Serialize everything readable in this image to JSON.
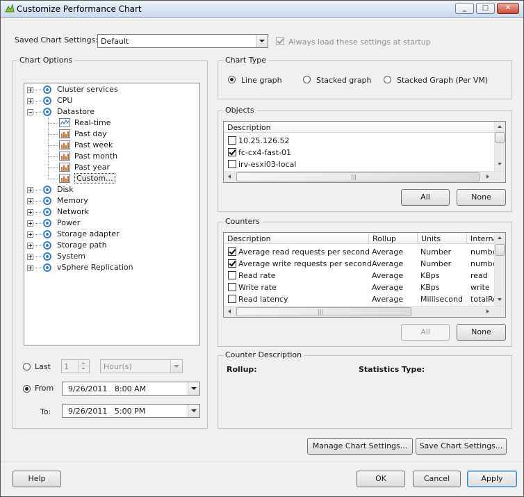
{
  "window": {
    "title": "Customize Performance Chart",
    "minimize_icon": "minimize-icon",
    "maximize_icon": "maximize-icon",
    "close_icon": "close-icon"
  },
  "saved_settings": {
    "label": "Saved Chart Settings:",
    "value": "Default",
    "always_load_label": "Always load these settings at startup",
    "always_load_checked": true
  },
  "chart_options": {
    "title": "Chart Options",
    "tree": [
      {
        "label": "Cluster services",
        "expanded": false,
        "children": []
      },
      {
        "label": "CPU",
        "expanded": false,
        "children": []
      },
      {
        "label": "Datastore",
        "expanded": true,
        "children": [
          {
            "label": "Real-time",
            "icon": "line-chart-icon"
          },
          {
            "label": "Past day",
            "icon": "bar-chart-icon"
          },
          {
            "label": "Past week",
            "icon": "bar-chart-icon"
          },
          {
            "label": "Past month",
            "icon": "bar-chart-icon"
          },
          {
            "label": "Past year",
            "icon": "bar-chart-icon"
          },
          {
            "label": "Custom...",
            "icon": "bar-chart-icon",
            "selected": true
          }
        ]
      },
      {
        "label": "Disk",
        "expanded": false,
        "children": []
      },
      {
        "label": "Memory",
        "expanded": false,
        "children": []
      },
      {
        "label": "Network",
        "expanded": false,
        "children": []
      },
      {
        "label": "Power",
        "expanded": false,
        "children": []
      },
      {
        "label": "Storage adapter",
        "expanded": false,
        "children": []
      },
      {
        "label": "Storage path",
        "expanded": false,
        "children": []
      },
      {
        "label": "System",
        "expanded": false,
        "children": []
      },
      {
        "label": "vSphere Replication",
        "expanded": false,
        "children": []
      }
    ],
    "time": {
      "last_label": "Last",
      "last_value": "1",
      "last_unit": "Hour(s)",
      "from_label": "From",
      "from_value": "9/26/2011   8:00 AM",
      "to_label": "To:",
      "to_value": "9/26/2011   5:00 PM",
      "selected": "from"
    }
  },
  "chart_type": {
    "title": "Chart Type",
    "options": [
      {
        "label": "Line graph",
        "selected": true
      },
      {
        "label": "Stacked graph",
        "selected": false
      },
      {
        "label": "Stacked Graph (Per VM)",
        "selected": false
      }
    ]
  },
  "objects": {
    "title": "Objects",
    "column": "Description",
    "rows": [
      {
        "label": "10.25.126.52",
        "checked": false
      },
      {
        "label": "fc-cx4-fast-01",
        "checked": true
      },
      {
        "label": "irv-esxi03-local",
        "checked": false
      }
    ],
    "scroll_glyph": "|||",
    "all_label": "All",
    "none_label": "None"
  },
  "counters": {
    "title": "Counters",
    "columns": [
      "Description",
      "Rollup",
      "Units",
      "Interna"
    ],
    "rows": [
      {
        "checked": true,
        "description": "Average read requests per second",
        "rollup": "Average",
        "units": "Number",
        "internal": "numbe"
      },
      {
        "checked": true,
        "description": "Average write requests per second",
        "rollup": "Average",
        "units": "Number",
        "internal": "numbe"
      },
      {
        "checked": false,
        "description": "Read rate",
        "rollup": "Average",
        "units": "KBps",
        "internal": "read"
      },
      {
        "checked": false,
        "description": "Write rate",
        "rollup": "Average",
        "units": "KBps",
        "internal": "write"
      },
      {
        "checked": false,
        "description": "Read latency",
        "rollup": "Average",
        "units": "Millisecond",
        "internal": "totalRe"
      }
    ],
    "scroll_glyph": "|||",
    "all_label": "All",
    "none_label": "None"
  },
  "counter_description": {
    "title": "Counter Description",
    "rollup_label": "Rollup:",
    "stats_type_label": "Statistics Type:"
  },
  "buttons": {
    "manage": "Manage Chart Settings...",
    "save": "Save Chart Settings...",
    "help": "Help",
    "ok": "OK",
    "cancel": "Cancel",
    "apply": "Apply"
  }
}
